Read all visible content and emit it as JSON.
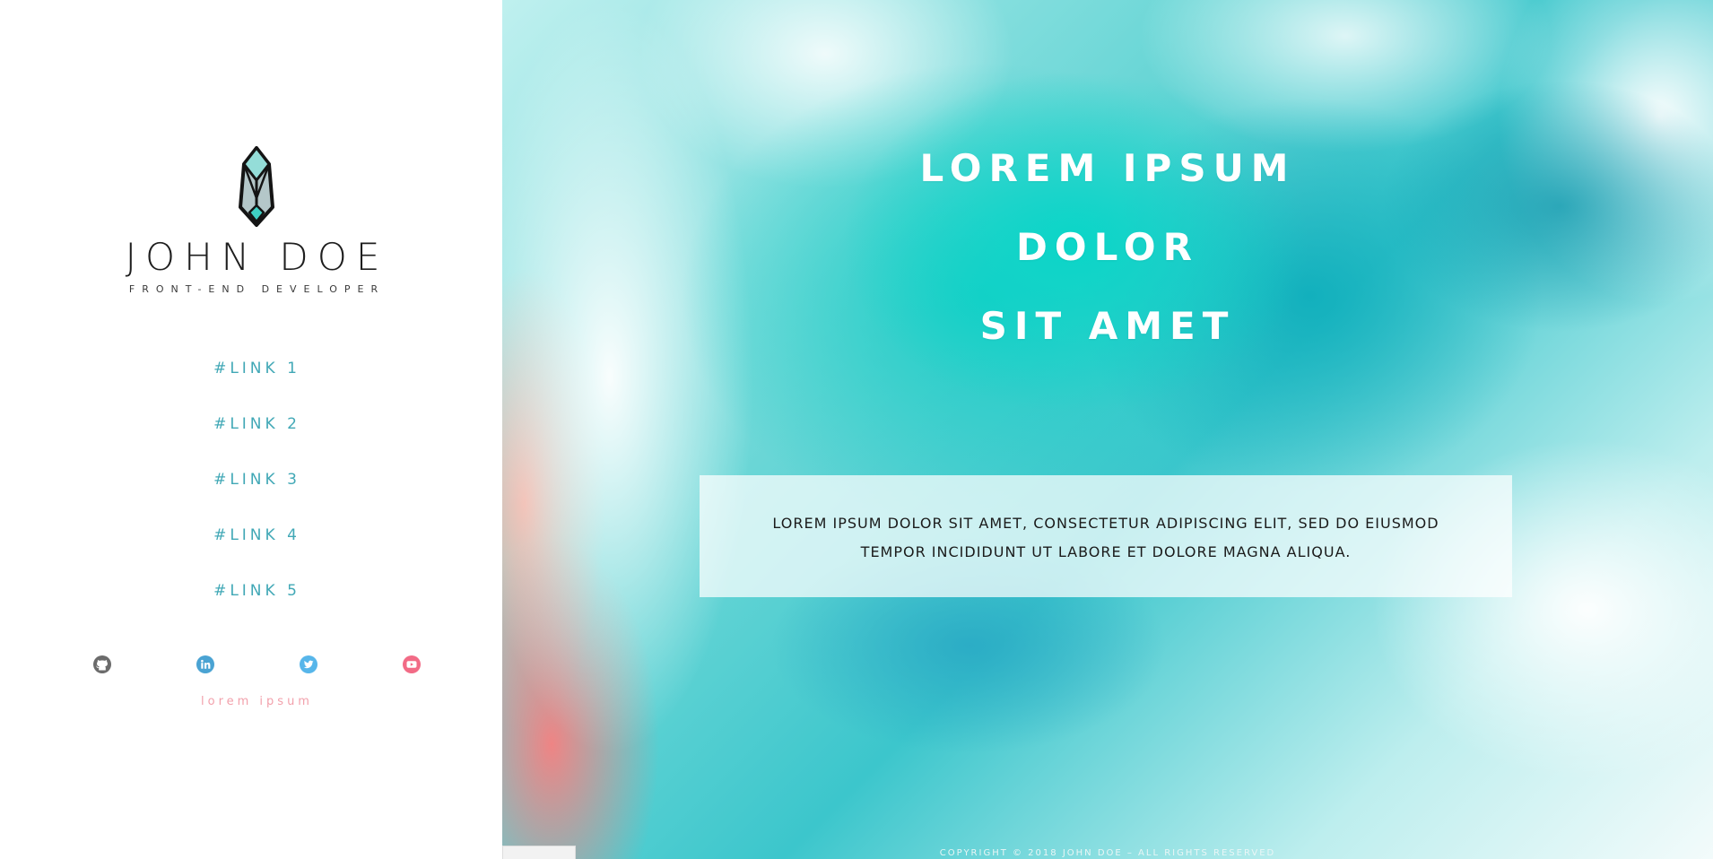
{
  "brand": {
    "name": "JOHN DOE",
    "role": "FRONT-END DEVELOPER"
  },
  "nav": {
    "links": [
      {
        "label": "#LINK 1"
      },
      {
        "label": "#LINK 2"
      },
      {
        "label": "#LINK 3"
      },
      {
        "label": "#LINK 4"
      },
      {
        "label": "#LINK 5"
      }
    ]
  },
  "social": {
    "icons": [
      "github-icon",
      "linkedin-icon",
      "twitter-icon",
      "youtube-icon"
    ],
    "note": "lorem ipsum"
  },
  "hero": {
    "title_lines": [
      "LOREM IPSUM",
      "DOLOR",
      "SIT AMET"
    ],
    "text": "LOREM IPSUM DOLOR SIT AMET, CONSECTETUR ADIPISCING ELIT, SED DO EIUSMOD TEMPOR INCIDIDUNT UT LABORE ET DOLORE MAGNA ALIQUA.",
    "copyright": "COPYRIGHT © 2018 JOHN DOE – ALL RIGHTS RESERVED"
  },
  "colors": {
    "link": "#41a8b6",
    "note": "#f2a0ab",
    "github": "#6b6b6b",
    "linkedin": "#4aa3d3",
    "twitter": "#57b6ea",
    "youtube": "#f26b86"
  }
}
